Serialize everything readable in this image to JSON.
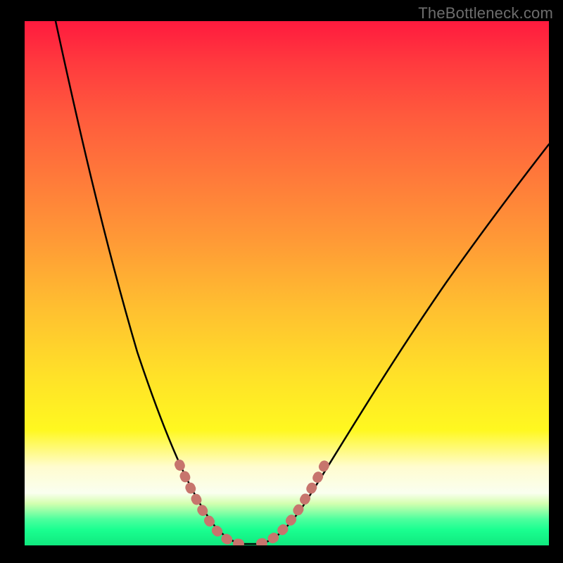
{
  "watermark": "TheBottleneck.com",
  "colors": {
    "background": "#000000",
    "curve": "#000000",
    "marker": "#c7756d",
    "gradient_top": "#ff1a3e",
    "gradient_bottom": "#10e87e"
  },
  "chart_data": {
    "type": "line",
    "title": "",
    "xlabel": "",
    "ylabel": "",
    "xlim": [
      0,
      100
    ],
    "ylim": [
      0,
      100
    ],
    "x": [
      0,
      2,
      4,
      6,
      8,
      10,
      12,
      14,
      16,
      18,
      20,
      22,
      24,
      26,
      28,
      30,
      32,
      34,
      35,
      36,
      37,
      38,
      39,
      40,
      41,
      42,
      43,
      44,
      46,
      48,
      50,
      55,
      60,
      65,
      70,
      75,
      80,
      85,
      90,
      95,
      100
    ],
    "values": [
      100,
      96,
      92,
      88,
      84,
      80,
      75,
      70,
      65,
      60,
      54,
      48,
      42,
      36,
      30,
      24,
      18,
      12,
      9,
      6,
      4,
      2,
      1,
      0,
      0,
      0,
      0,
      1,
      3,
      6,
      9,
      18,
      27,
      34,
      41,
      47,
      53,
      58,
      62,
      66,
      69
    ],
    "highlight_zones": [
      {
        "x_range": [
          31,
          36
        ],
        "description": "left approach to minimum"
      },
      {
        "x_range": [
          43,
          48
        ],
        "description": "right approach from minimum"
      }
    ],
    "minimum_value_x_range": [
      38,
      44
    ]
  }
}
